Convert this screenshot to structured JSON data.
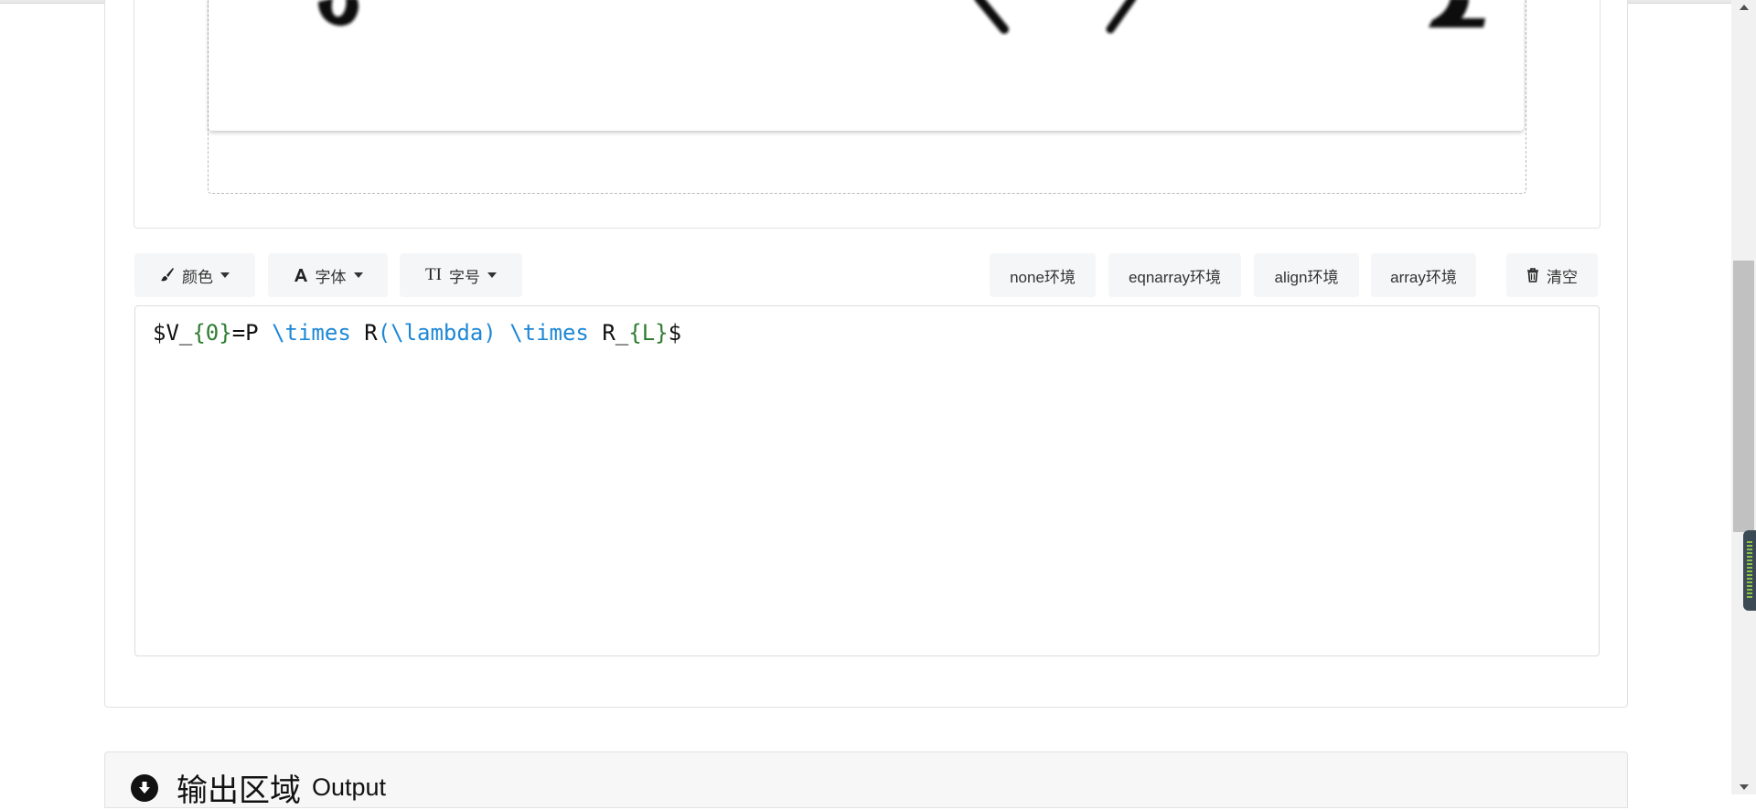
{
  "toolbar": {
    "color_label": "颜色",
    "font_label": "字体",
    "size_label": "字号",
    "size_icon_text": "TI",
    "env_none": "none环境",
    "env_eqnarray": "eqnarray环境",
    "env_align": "align环境",
    "env_array": "array环境",
    "clear_label": "清空"
  },
  "editor": {
    "tokens": {
      "t1": "$V_",
      "t2": "{0}",
      "t3": "=P ",
      "t4": "\\times",
      "t5": " R",
      "t6": "(\\lambda)",
      "t7": " ",
      "t8": "\\times",
      "t9": " R_",
      "t10": "{L}",
      "t11": "$"
    }
  },
  "output": {
    "title_zh": "输出区域",
    "title_en": "Output"
  },
  "colors": {
    "keyword": "#1e88d6",
    "brace": "#2e7d32",
    "button_bg": "#f5f6f7"
  },
  "icons": {
    "color": "paintbrush-icon",
    "font": "font-icon",
    "size": "text-height-icon",
    "clear": "trash-icon",
    "output": "arrow-circle-down-icon"
  }
}
